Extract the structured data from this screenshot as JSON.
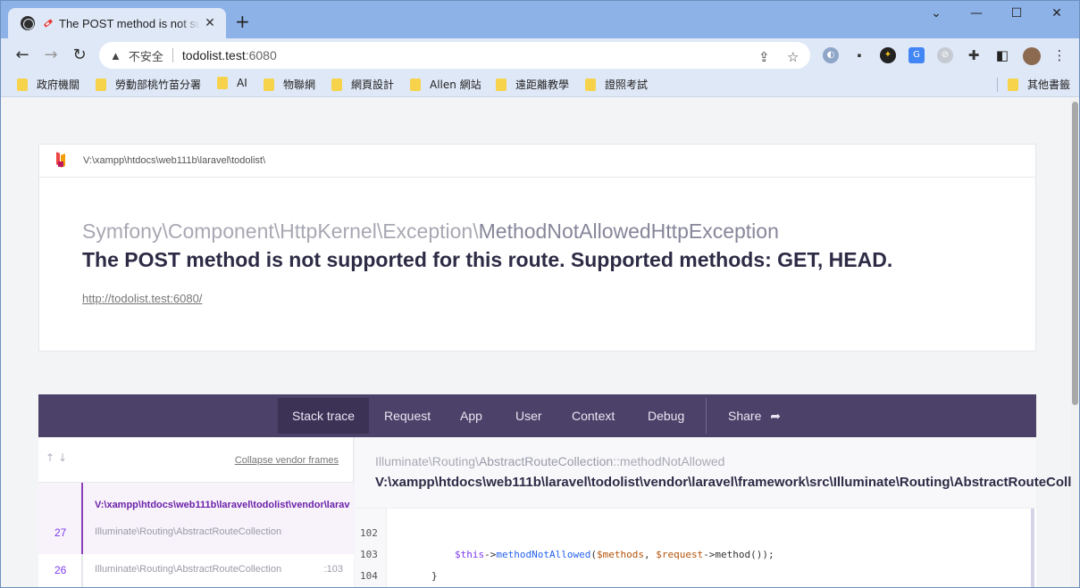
{
  "browser": {
    "tab_title": "The POST method is not supported for this route. Supported methods: GET, HEAD.",
    "new_tab_label": "+",
    "minimize_label": "⌄",
    "restore_label": "—",
    "maximize_label": "☐",
    "close_label": "✕",
    "insecure_label": "不安全",
    "host": "todolist.test",
    "port": ":6080",
    "bookmarks": [
      "政府機關",
      "勞動部桃竹苗分署",
      "AI",
      "物聯網",
      "網頁設計",
      "Allen 網站",
      "遠距離教學",
      "證照考試"
    ],
    "other_bookmarks": "其他書籤",
    "colors": {
      "chrome": "#8db2e8",
      "toolbar": "#dfe8f7"
    }
  },
  "error": {
    "path": "V:\\xampp\\htdocs\\web111b\\laravel\\todolist\\",
    "exception_namespace": "Symfony\\Component\\HttpKernel\\Exception\\",
    "exception_class": "MethodNotAllowedHttpException",
    "message": "The POST method is not supported for this route. Supported methods: GET, HEAD.",
    "url": "http://todolist.test:6080/"
  },
  "nav": {
    "tabs": [
      "Stack trace",
      "Request",
      "App",
      "User",
      "Context",
      "Debug"
    ],
    "share": "Share",
    "active": "Stack trace",
    "colors": {
      "bar": "#4c4168",
      "active": "#3b3256"
    }
  },
  "stack": {
    "collapse_label": "Collapse vendor frames",
    "active_file": "V:\\xampp\\htdocs\\web111b\\laravel\\todolist\\vendor\\laravel\\framework\\src\\Illuminate\\Routing\\AbstractRouteCollection.php",
    "frames": [
      {
        "number": "27",
        "class": "Illuminate\\Routing\\AbstractRouteCollection",
        "line": ""
      },
      {
        "number": "26",
        "class": "Illuminate\\Routing\\AbstractRouteCollection",
        "line": ":103"
      }
    ]
  },
  "detail": {
    "class_prefix": "Illuminate\\Routing\\",
    "class_name": "AbstractRouteCollection",
    "method": "::methodNotAllowed",
    "file": "V:\\xampp\\htdocs\\web111b\\laravel\\todolist\\vendor\\laravel\\framework\\src\\Illuminate\\Routing\\AbstractRouteCollection.php",
    "line_numbers": [
      "102",
      "103",
      "104"
    ],
    "code": {
      "this_kw": "$this",
      "arrow": "->",
      "method_call": "methodNotAllowed",
      "args_open": "(",
      "methods_var": "$methods",
      "comma": ", ",
      "request_var": "$request",
      "request_call": "->method());",
      "closing_brace": "}"
    }
  }
}
